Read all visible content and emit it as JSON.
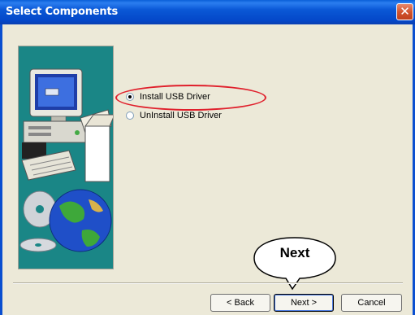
{
  "window": {
    "title": "Select Components",
    "close_icon": "close-icon"
  },
  "options": [
    {
      "label": "Install USB Driver",
      "checked": true
    },
    {
      "label": "UnInstall USB Driver",
      "checked": false
    }
  ],
  "annotation": {
    "callout_label": "Next",
    "highlight_color": "#e0202c"
  },
  "buttons": {
    "back": "< Back",
    "next": "Next >",
    "cancel": "Cancel"
  },
  "colors": {
    "titlebar": "#0447c8",
    "dialog_bg": "#ece9d8",
    "graphic_bg": "#1a8686"
  }
}
